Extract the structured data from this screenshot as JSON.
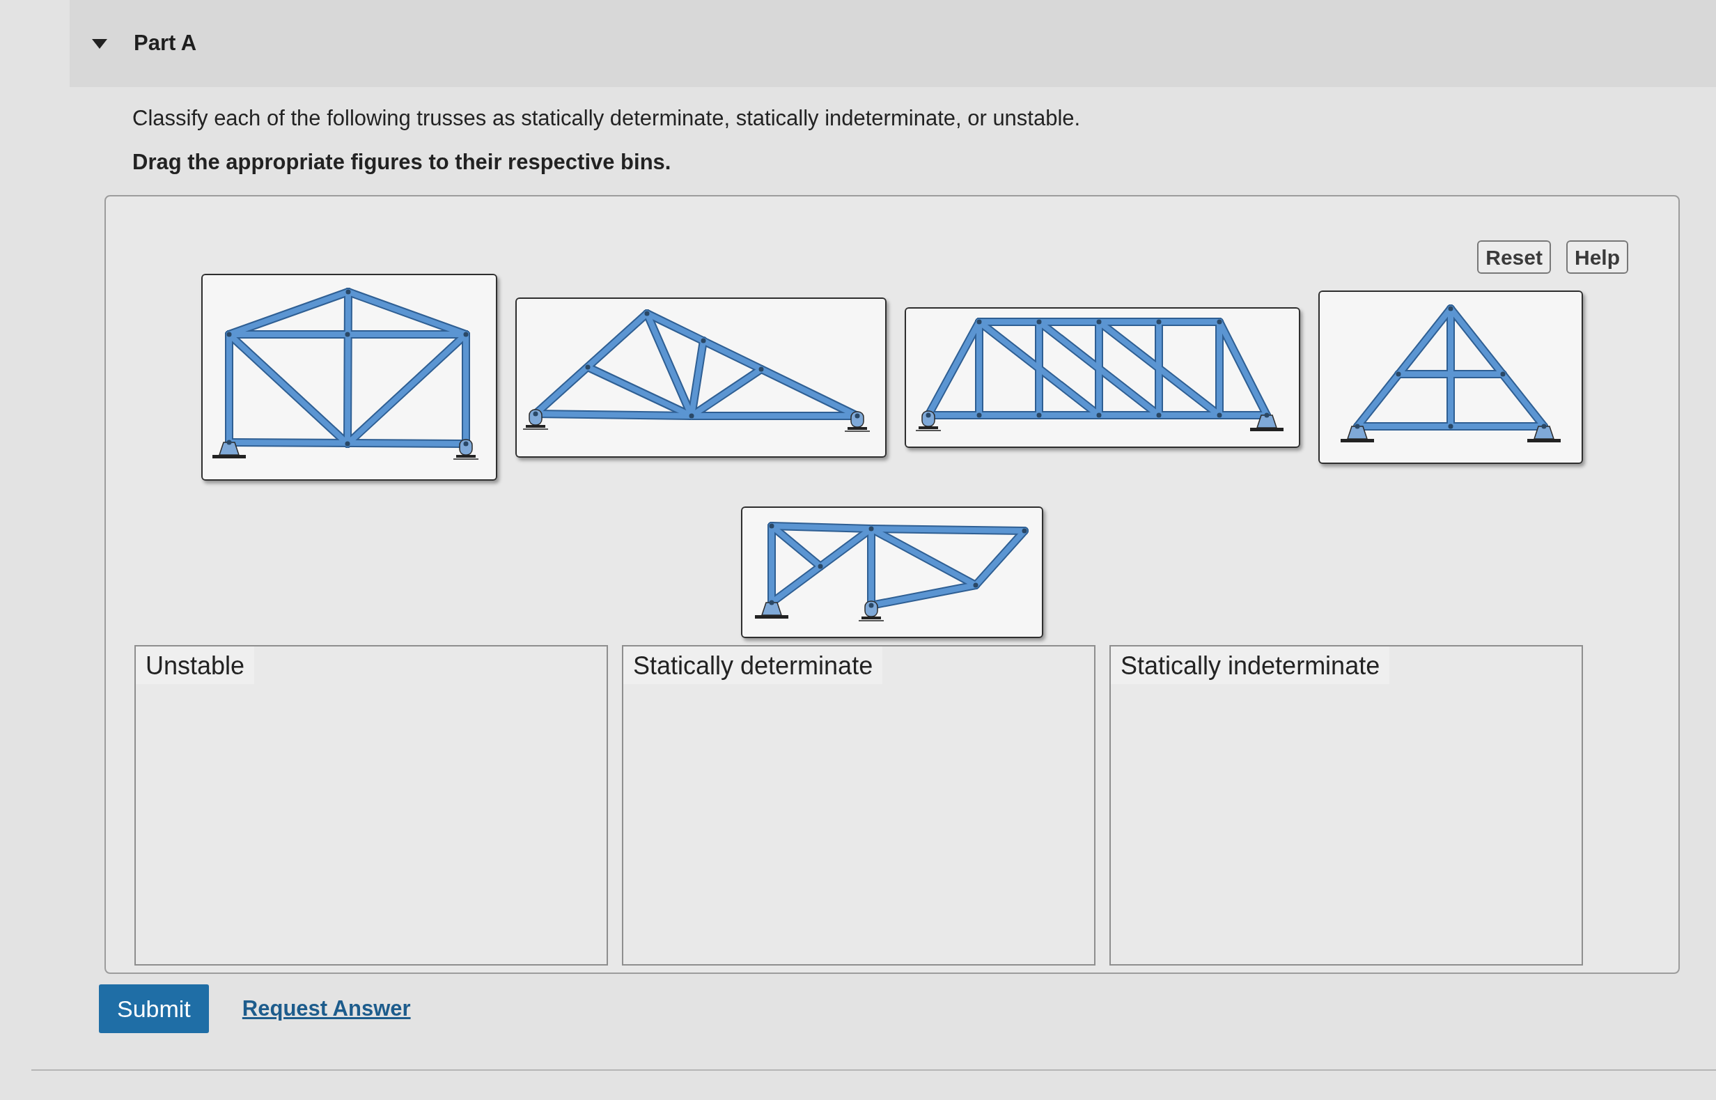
{
  "section": {
    "title": "Part A",
    "expanded": true
  },
  "question": "Classify each of the following trusses as statically determinate, statically indeterminate, or unstable.",
  "directive": "Drag the appropriate figures to their respective bins.",
  "panel": {
    "buttons": [
      "Reset",
      "Help"
    ],
    "figures": [
      {
        "kind": "gable"
      },
      {
        "kind": "roof"
      },
      {
        "kind": "bridge"
      },
      {
        "kind": "aframe"
      },
      {
        "kind": "double"
      }
    ],
    "bins": [
      "Unstable",
      "Statically determinate",
      "Statically indeterminate"
    ]
  },
  "actions": {
    "submit": "Submit",
    "request_answer": "Request Answer"
  }
}
